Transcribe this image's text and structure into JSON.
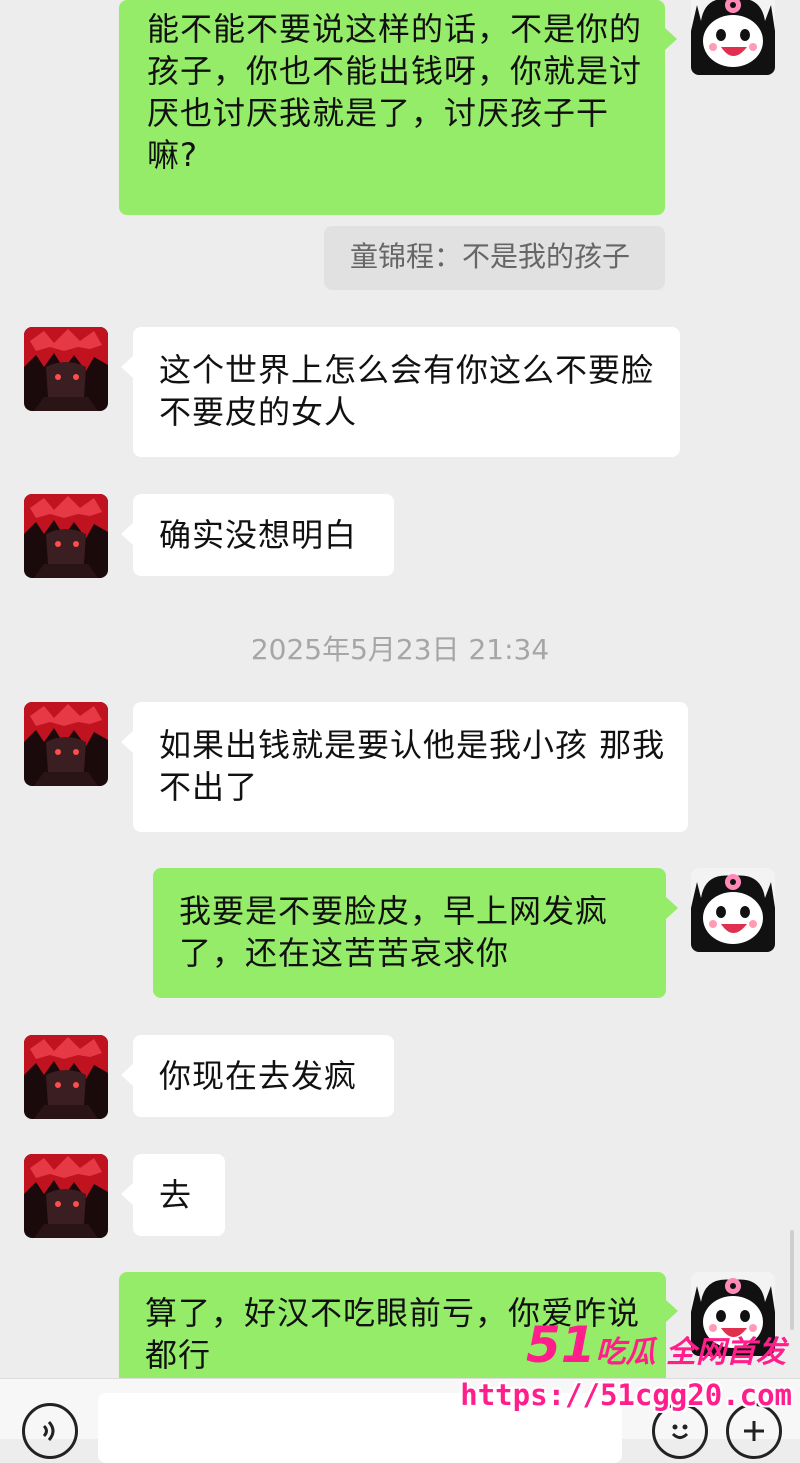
{
  "messages": [
    {
      "side": "right",
      "text": "能不能不要说这样的话，不是你的孩子，你也不能出钱呀，你就是讨厌也讨厌我就是了，讨厌孩子干嘛?"
    },
    {
      "type": "quote",
      "text": "童锦程：不是我的孩子"
    },
    {
      "side": "left",
      "text": "这个世界上怎么会有你这么不要脸不要皮的女人"
    },
    {
      "side": "left",
      "text": "确实没想明白"
    },
    {
      "type": "time",
      "text": "2025年5月23日 21:34"
    },
    {
      "side": "left",
      "text": "如果出钱就是要认他是我小孩 那我不出了"
    },
    {
      "side": "right",
      "text": "我要是不要脸皮，早上网发疯了，还在这苦苦哀求你"
    },
    {
      "side": "left",
      "text": "你现在去发疯"
    },
    {
      "side": "left",
      "text": "去"
    },
    {
      "side": "right",
      "text": "算了，好汉不吃眼前亏，你爱咋说都行"
    }
  ],
  "icons": {
    "left_avatar": "red-haired-anime-avatar",
    "right_avatar": "kuromi-avatar",
    "voice": "voice-icon",
    "emoji": "emoji-icon",
    "add": "add-icon"
  },
  "colors": {
    "sent_bubble": "#95ec69",
    "received_bubble": "#ffffff",
    "background": "#ededed",
    "watermark": "#ff1e8c"
  },
  "watermark": {
    "num": "51",
    "brand": "吃瓜 全网首发",
    "url": "https://51cgg20.com"
  }
}
